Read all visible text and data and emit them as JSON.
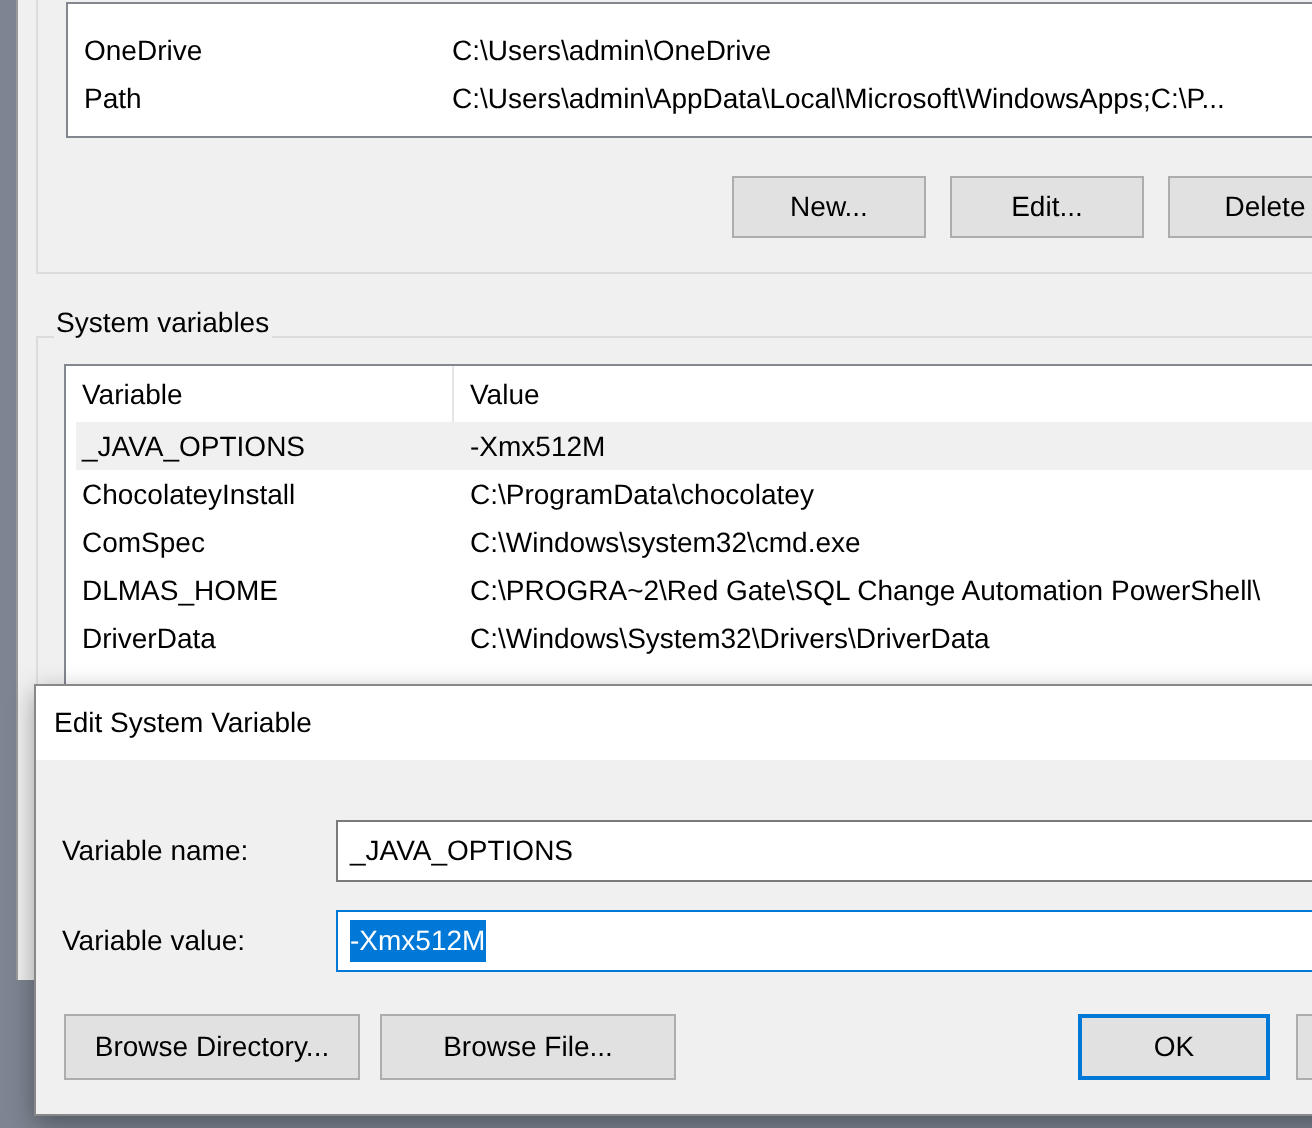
{
  "user_variables": {
    "rows": [
      {
        "variable": "OneDrive",
        "value": "C:\\Users\\admin\\OneDrive"
      },
      {
        "variable": "Path",
        "value": "C:\\Users\\admin\\AppData\\Local\\Microsoft\\WindowsApps;C:\\P..."
      }
    ],
    "buttons": [
      "New...",
      "Edit...",
      "Delete"
    ]
  },
  "system_variables": {
    "title": "System variables",
    "columns": [
      "Variable",
      "Value"
    ],
    "rows": [
      {
        "variable": "_JAVA_OPTIONS",
        "value": "-Xmx512M",
        "selected": true
      },
      {
        "variable": "ChocolateyInstall",
        "value": "C:\\ProgramData\\chocolatey",
        "selected": false
      },
      {
        "variable": "ComSpec",
        "value": "C:\\Windows\\system32\\cmd.exe",
        "selected": false
      },
      {
        "variable": "DLMAS_HOME",
        "value": "C:\\PROGRA~2\\Red Gate\\SQL Change Automation PowerShell\\",
        "selected": false
      },
      {
        "variable": "DriverData",
        "value": "C:\\Windows\\System32\\Drivers\\DriverData",
        "selected": false
      }
    ]
  },
  "dialog": {
    "title": "Edit System Variable",
    "fields": [
      {
        "label": "Variable name:",
        "value": "_JAVA_OPTIONS",
        "focused": false,
        "text_selected": false
      },
      {
        "label": "Variable value:",
        "value": "-Xmx512M",
        "focused": true,
        "text_selected": true
      }
    ],
    "buttons": [
      {
        "label": "Browse Directory...",
        "default": false
      },
      {
        "label": "Browse File...",
        "default": false
      },
      {
        "label": "OK",
        "default": true
      }
    ]
  }
}
